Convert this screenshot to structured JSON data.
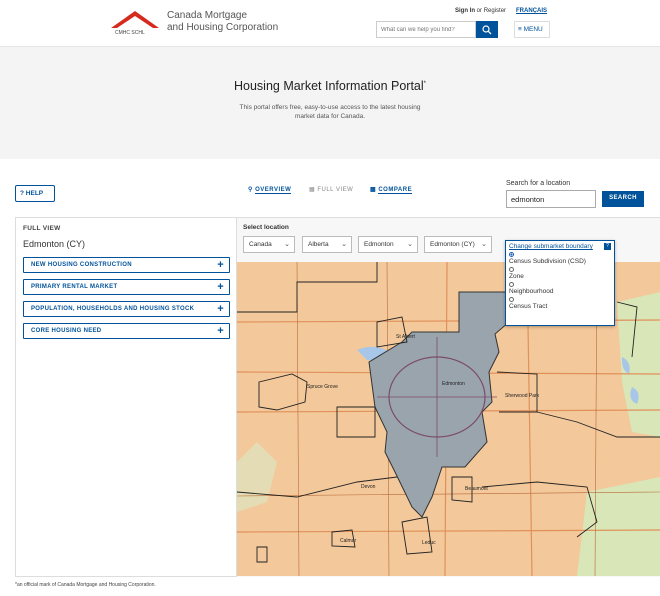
{
  "header": {
    "logo_text": "CMHC SCHL",
    "org_line1": "Canada Mortgage",
    "org_line2": "and Housing Corporation",
    "signin_label": "Sign In",
    "or_label": "or",
    "register_label": "Register",
    "language_label": "FRANÇAIS",
    "search_placeholder": "What can we help you find?",
    "menu_label": "MENU"
  },
  "hero": {
    "title": "Housing Market Information Portal",
    "title_mark": "*",
    "description": "This portal offers free, easy-to-use access to the latest housing market data for Canada."
  },
  "toolbar": {
    "help_label": "HELP",
    "help_icon": "?",
    "tabs": [
      {
        "label": "OVERVIEW",
        "icon": "pin-icon",
        "active": false
      },
      {
        "label": "FULL VIEW",
        "icon": "grid-icon",
        "active": true
      },
      {
        "label": "COMPARE",
        "icon": "bar-chart-icon",
        "active": false
      }
    ],
    "search_location_label": "Search for a location",
    "search_location_value": "edmonton",
    "search_button_label": "SEARCH"
  },
  "panel": {
    "title": "FULL VIEW",
    "location": "Edmonton (CY)",
    "sections": [
      {
        "label": "NEW HOUSING CONSTRUCTION"
      },
      {
        "label": "PRIMARY RENTAL MARKET"
      },
      {
        "label": "POPULATION, HOUSEHOLDS AND HOUSING STOCK"
      },
      {
        "label": "CORE HOUSING NEED"
      }
    ]
  },
  "location_select": {
    "label": "Select location",
    "country": "Canada",
    "province": "Alberta",
    "cma": "Edmonton",
    "csd": "Edmonton (CY)"
  },
  "boundary": {
    "title": "Change submarket boundary",
    "help_icon": "?",
    "options": [
      {
        "label": "Census Subdivision (CSD)",
        "selected": true
      },
      {
        "label": "Zone",
        "selected": false
      },
      {
        "label": "Neighbourhood",
        "selected": false
      },
      {
        "label": "Census Tract",
        "selected": false
      }
    ]
  },
  "map_labels": {
    "edmonton": "Edmonton",
    "st_albert": "St Albert",
    "spruce_grove": "Spruce Grove",
    "sherwood_park": "Sherwood Park",
    "beaumont": "Beaumont",
    "devon": "Devon",
    "leduc": "Leduc",
    "calmar": "Calmar"
  },
  "footnote": "*an official mark of Canada Mortgage and Housing Corporation.",
  "colors": {
    "brand_blue": "#00529b",
    "logo_red": "#d52b1e",
    "map_land": "#f3c89a",
    "map_selected": "#9aa4ad",
    "map_green": "#d9e6b8"
  }
}
